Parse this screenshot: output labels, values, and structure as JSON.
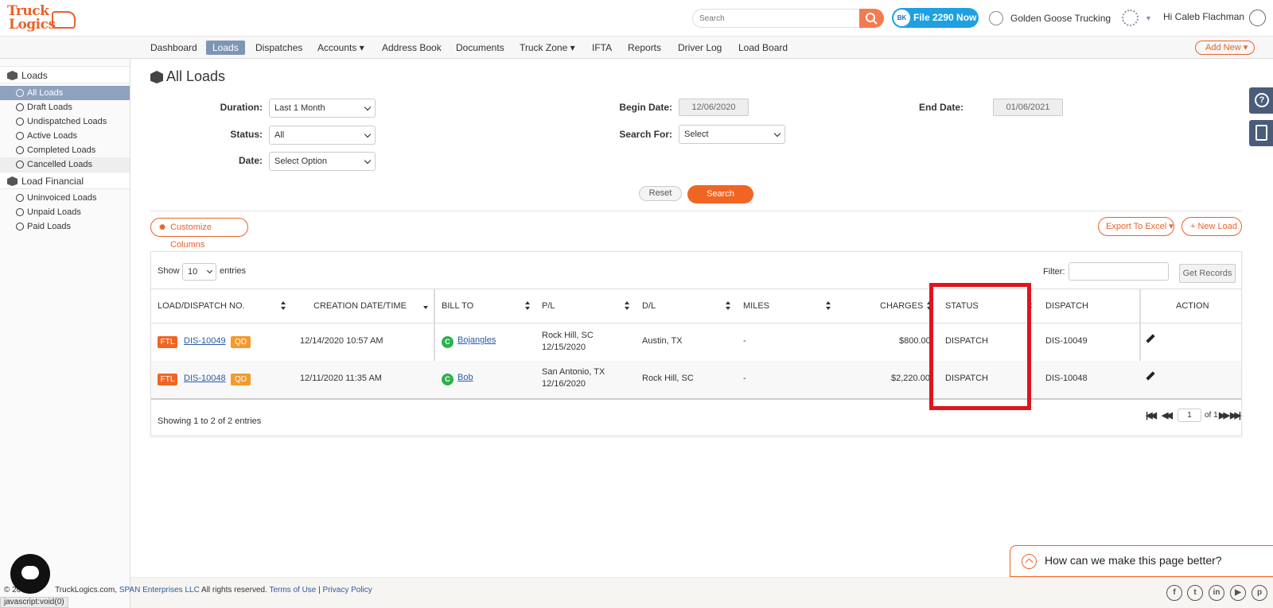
{
  "header": {
    "logo_line1": "Truck",
    "logo_line2": "Logics",
    "search_placeholder": "Search",
    "file_badge": "BK",
    "file_label": "File 2290 Now",
    "company": "Golden Goose Trucking",
    "greeting": "Hi Caleb Flachman"
  },
  "nav": {
    "items": [
      "Dashboard",
      "Loads",
      "Dispatches",
      "Accounts ▾",
      "Address Book",
      "Documents",
      "Truck Zone ▾",
      "IFTA",
      "Reports",
      "Driver Log",
      "Load Board"
    ],
    "active": "Loads",
    "add_new": "Add New ▾"
  },
  "sidebar": {
    "group1": "Loads",
    "items1": [
      "All Loads",
      "Draft Loads",
      "Undispatched Loads",
      "Active Loads",
      "Completed Loads",
      "Cancelled Loads"
    ],
    "group2": "Load Financial",
    "items2": [
      "Uninvoiced Loads",
      "Unpaid Loads",
      "Paid Loads"
    ]
  },
  "page": {
    "title": "All Loads",
    "filters": {
      "duration_label": "Duration:",
      "duration_value": "Last 1 Month",
      "status_label": "Status:",
      "status_value": "All",
      "date_label": "Date:",
      "date_value": "Select Option",
      "begin_label": "Begin Date:",
      "begin_value": "12/06/2020",
      "searchfor_label": "Search For:",
      "searchfor_value": "Select",
      "end_label": "End Date:",
      "end_value": "01/06/2021"
    },
    "reset": "Reset",
    "search": "Search",
    "customize": "Customize Columns",
    "export": "Export To Excel ▾",
    "new_load": "+ New Load"
  },
  "table": {
    "show": "Show",
    "entries_value": "10",
    "entries": "entries",
    "filter": "Filter:",
    "get_records": "Get Records",
    "headers": [
      "LOAD/DISPATCH NO.",
      "CREATION DATE/TIME",
      "BILL TO",
      "P/L",
      "D/L",
      "MILES",
      "CHARGES",
      "STATUS",
      "DISPATCH",
      "ACTION"
    ],
    "rows": [
      {
        "ftl": "FTL",
        "no": "DIS-10049",
        "qd": "QD",
        "created": "12/14/2020 10:57 AM",
        "c": "C",
        "bill_to": "Bojangles",
        "pl1": "Rock Hill, SC",
        "pl2": "12/15/2020",
        "dl": "Austin, TX",
        "miles": "-",
        "charges": "$800.00",
        "status": "DISPATCH",
        "dispatch": "DIS-10049"
      },
      {
        "ftl": "FTL",
        "no": "DIS-10048",
        "qd": "QD",
        "created": "12/11/2020 11:35 AM",
        "c": "C",
        "bill_to": "Bob",
        "pl1": "San Antonio, TX",
        "pl2": "12/16/2020",
        "dl": "Rock Hill, SC",
        "miles": "-",
        "charges": "$2,220.00",
        "status": "DISPATCH",
        "dispatch": "DIS-10048"
      }
    ],
    "showing": "Showing 1 to 2 of 2 entries",
    "page_value": "1",
    "page_of": "of 1"
  },
  "feedback": "How can we make this page better?",
  "footer": {
    "copyright": "© 20",
    "copyright2": "TruckLogics.com,",
    "span": "SPAN Enterprises LLC",
    "rights": "All rights reserved.",
    "terms": "Terms of Use",
    "sep": "|",
    "privacy": "Privacy Policy",
    "status_url": "javascript:void(0)",
    "social": [
      "f",
      "t",
      "in",
      "▶",
      "p"
    ]
  }
}
